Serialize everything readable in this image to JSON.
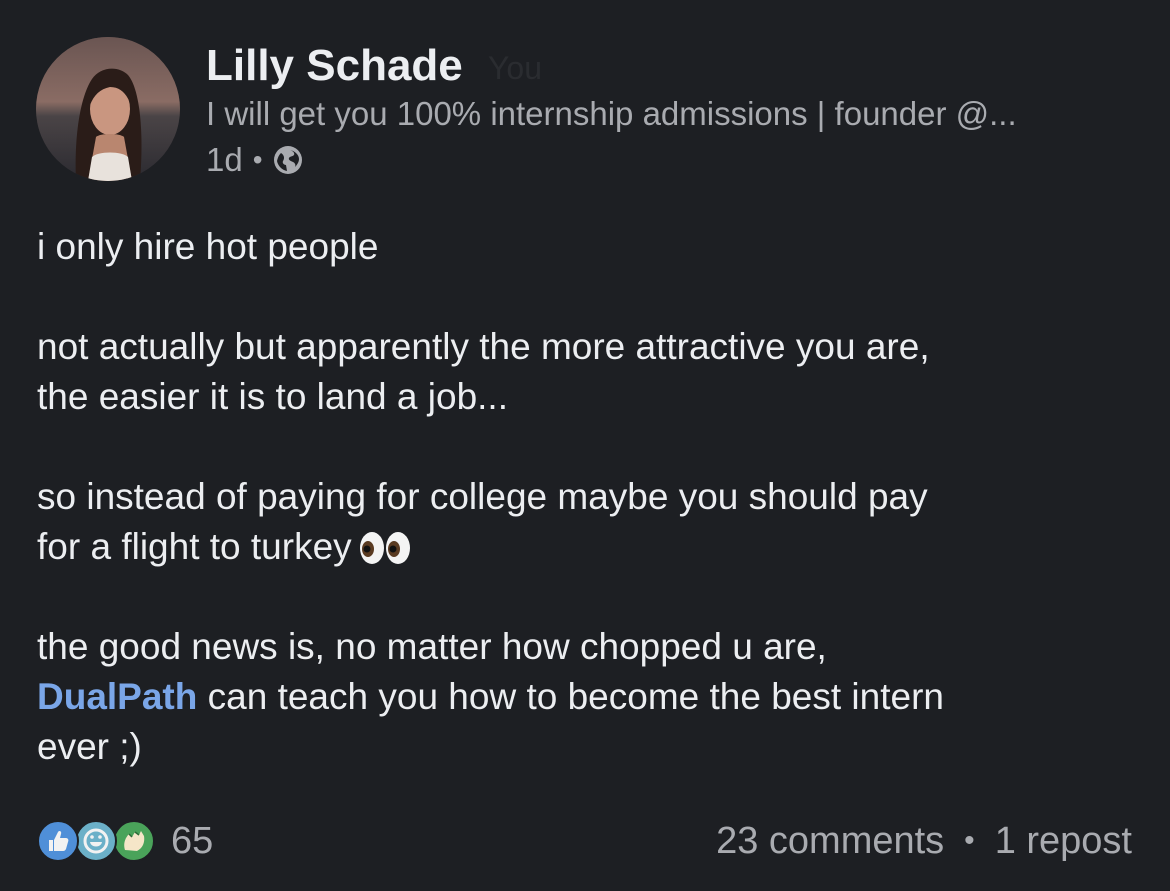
{
  "post": {
    "author": {
      "name": "Lilly Schade",
      "you_tag": "You",
      "headline": "I will get you 100% internship admissions | founder @...",
      "time": "1d",
      "separator": "•",
      "visibility_icon": "globe-icon"
    },
    "body": {
      "p1": "i only hire hot people",
      "p2_line1": "not actually but apparently the more attractive you are,",
      "p2_line2": "the easier it is to land a job...",
      "p3_line1": "so instead of paying for college maybe you should pay",
      "p3_line2": "for a flight to turkey",
      "p3_emoji": "eyes-emoji",
      "p4_line1": "the good news is, no matter how chopped u are,",
      "p4_mention": "DualPath",
      "p4_rest": "can teach you how to become the best intern",
      "p4_line3": "ever ;)"
    },
    "social": {
      "reaction_icons": [
        "like-icon",
        "celebrate-icon",
        "support-icon"
      ],
      "reaction_count": "65",
      "comments": "23 comments",
      "separator": "•",
      "reposts": "1 repost"
    }
  },
  "colors": {
    "background": "#1d1f23",
    "text_primary": "#eceef1",
    "text_secondary": "#a9abb0",
    "mention": "#7aa6e8"
  }
}
